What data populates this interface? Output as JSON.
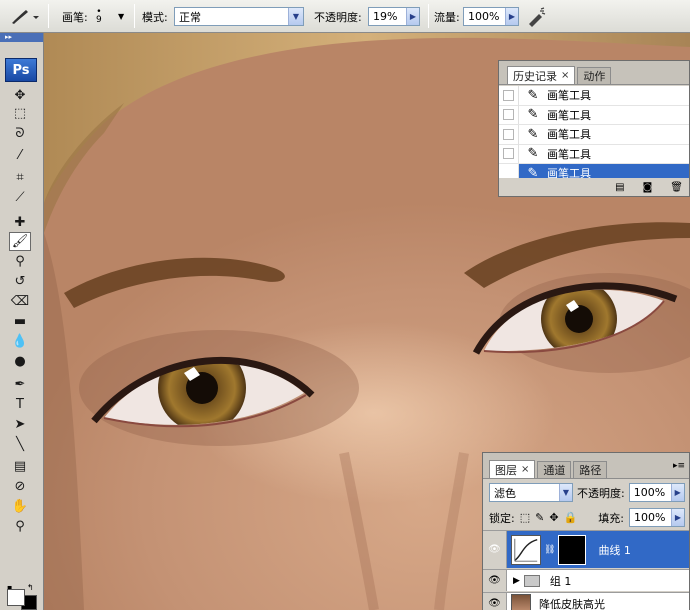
{
  "options_bar": {
    "brush_label": "画笔:",
    "brush_size": "9",
    "mode_label": "模式:",
    "mode_value": "正常",
    "opacity_label": "不透明度:",
    "opacity_value": "19%",
    "flow_label": "流量:",
    "flow_value": "100%"
  },
  "toolbox": {
    "logo": "Ps",
    "grip": "▸▸",
    "tools": [
      {
        "name": "move-tool-icon",
        "glyph": "✥"
      },
      {
        "name": "marquee-tool-icon",
        "glyph": "⬚"
      },
      {
        "name": "lasso-tool-icon",
        "glyph": "ᘐ"
      },
      {
        "name": "magic-wand-tool-icon",
        "glyph": "⁄"
      },
      {
        "name": "crop-tool-icon",
        "glyph": "⌗"
      },
      {
        "name": "slice-tool-icon",
        "glyph": "⟋"
      },
      {
        "name": "healing-brush-tool-icon",
        "glyph": "✚"
      },
      {
        "name": "brush-tool-icon",
        "glyph": "🖌",
        "active": true
      },
      {
        "name": "clone-stamp-tool-icon",
        "glyph": "⚲"
      },
      {
        "name": "history-brush-tool-icon",
        "glyph": "↺"
      },
      {
        "name": "eraser-tool-icon",
        "glyph": "⌫"
      },
      {
        "name": "gradient-tool-icon",
        "glyph": "▬"
      },
      {
        "name": "blur-tool-icon",
        "glyph": "💧"
      },
      {
        "name": "dodge-tool-icon",
        "glyph": "●"
      },
      {
        "name": "pen-tool-icon",
        "glyph": "✒"
      },
      {
        "name": "type-tool-icon",
        "glyph": "T"
      },
      {
        "name": "path-selection-tool-icon",
        "glyph": "➤"
      },
      {
        "name": "line-tool-icon",
        "glyph": "╲"
      },
      {
        "name": "notes-tool-icon",
        "glyph": "▤"
      },
      {
        "name": "eyedropper-tool-icon",
        "glyph": "⊘"
      },
      {
        "name": "hand-tool-icon",
        "glyph": "✋"
      },
      {
        "name": "zoom-tool-icon",
        "glyph": "⚲"
      }
    ]
  },
  "history_panel": {
    "tabs": [
      {
        "label": "历史记录",
        "active": true,
        "close": "×"
      },
      {
        "label": "动作",
        "active": false,
        "close": ""
      }
    ],
    "rows": [
      {
        "label": "画笔工具",
        "selected": false
      },
      {
        "label": "画笔工具",
        "selected": false
      },
      {
        "label": "画笔工具",
        "selected": false
      },
      {
        "label": "画笔工具",
        "selected": false
      },
      {
        "label": "画笔工具",
        "selected": true
      }
    ]
  },
  "layers_panel": {
    "tabs": [
      {
        "label": "图层",
        "active": true,
        "close": "×"
      },
      {
        "label": "通道",
        "active": false,
        "close": ""
      },
      {
        "label": "路径",
        "active": false,
        "close": ""
      }
    ],
    "blend_mode": "滤色",
    "opacity_label": "不透明度:",
    "opacity_value": "100%",
    "lock_label": "锁定:",
    "fill_label": "填充:",
    "fill_value": "100%",
    "layers": [
      {
        "name": "曲线 1",
        "selected": true
      },
      {
        "name": "组 1",
        "selected": false
      },
      {
        "name": "降低皮肤高光",
        "selected": false
      }
    ]
  }
}
